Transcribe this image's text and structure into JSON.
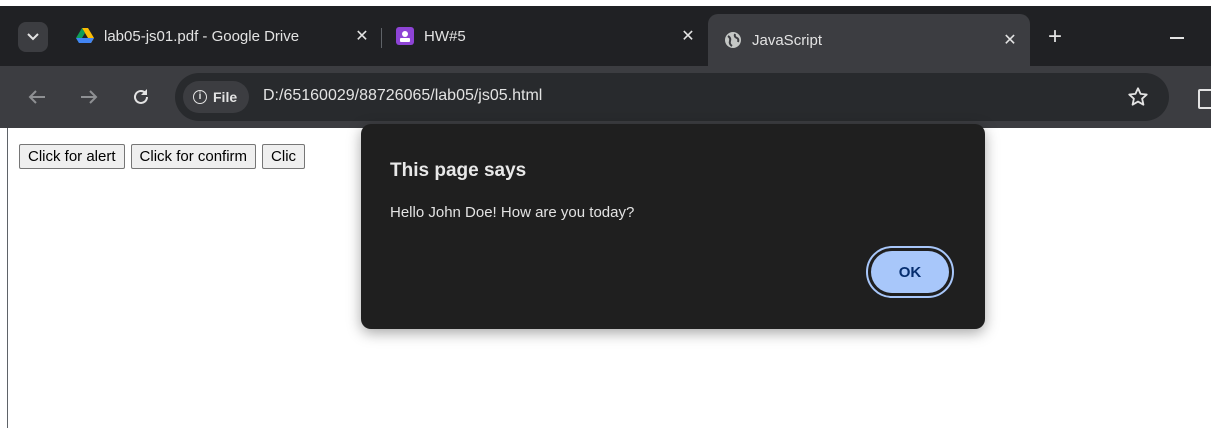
{
  "tabs": [
    {
      "title": "lab05-js01.pdf - Google Drive",
      "icon": "google-drive-icon",
      "active": false
    },
    {
      "title": "HW#5",
      "icon": "classroom-icon",
      "active": false
    },
    {
      "title": "JavaScript",
      "icon": "globe-icon",
      "active": true
    }
  ],
  "tabstrip": {
    "close_glyph": "✕",
    "new_tab_glyph": "+"
  },
  "toolbar": {
    "chip_label": "File",
    "url": "D:/65160029/88726065/lab05/js05.html"
  },
  "page": {
    "buttons": [
      "Click for alert",
      "Click for confirm",
      "Clic"
    ]
  },
  "dialog": {
    "title": "This page says",
    "message": "Hello John Doe! How are you today?",
    "ok_label": "OK"
  },
  "colors": {
    "tabstrip_bg": "#202124",
    "toolbar_bg": "#3c3d41",
    "dialog_bg": "#1f1f1f",
    "ok_button": "#a8c7fa"
  }
}
